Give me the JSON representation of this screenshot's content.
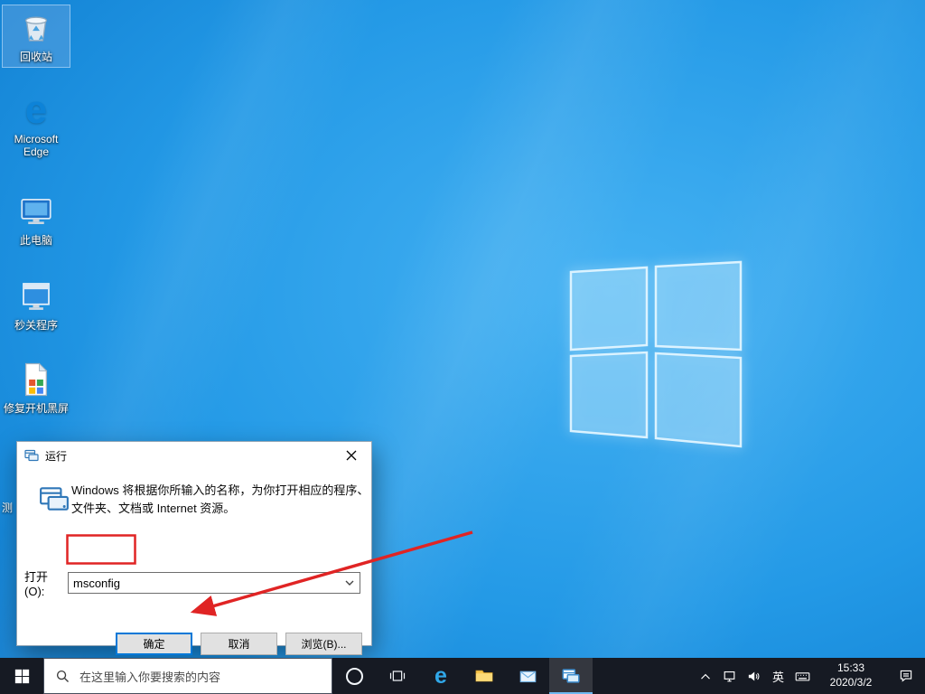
{
  "colors": {
    "taskbar_bg": "#161a23",
    "accent_blue": "#0078d7",
    "annotation_red": "#e02424",
    "wallpaper_blue": "#1e93e2"
  },
  "desktop": {
    "icons": [
      {
        "label": "回收站"
      },
      {
        "label": "Microsoft Edge"
      },
      {
        "label": "此电脑"
      },
      {
        "label": "秒关程序"
      },
      {
        "label": "修复开机黑屏"
      }
    ],
    "partial_icon_label": "测"
  },
  "run_dialog": {
    "title": "运行",
    "description": "Windows 将根据你所输入的名称，为你打开相应的程序、文件夹、文档或 Internet 资源。",
    "open_label": "打开(O):",
    "input_value": "msconfig",
    "ok_label": "确定",
    "cancel_label": "取消",
    "browse_label": "浏览(B)..."
  },
  "taskbar": {
    "search_placeholder": "在这里输入你要搜索的内容",
    "ime_label": "英",
    "clock": {
      "time": "15:33",
      "date": "2020/3/2"
    }
  }
}
